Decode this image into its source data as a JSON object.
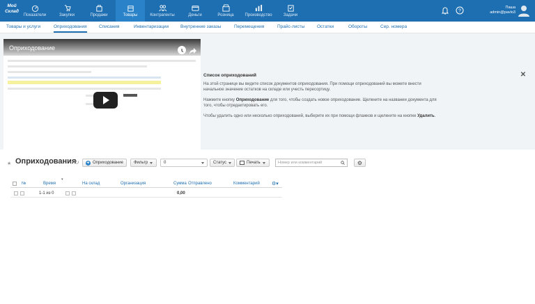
{
  "logo": "Мой Склад",
  "nav": [
    {
      "label": "Показатели",
      "icon": "dashboard-icon"
    },
    {
      "label": "Закупки",
      "icon": "purchases-icon"
    },
    {
      "label": "Продажи",
      "icon": "sales-icon"
    },
    {
      "label": "Товары",
      "icon": "goods-icon",
      "active": true
    },
    {
      "label": "Контрагенты",
      "icon": "contacts-icon"
    },
    {
      "label": "Деньги",
      "icon": "money-icon"
    },
    {
      "label": "Розница",
      "icon": "retail-icon"
    },
    {
      "label": "Производство",
      "icon": "production-icon"
    },
    {
      "label": "Задачи",
      "icon": "tasks-icon"
    }
  ],
  "user": {
    "name": "Паша",
    "account": "admin@pavlo3"
  },
  "subnav": [
    "Товары и услуги",
    "Оприходования",
    "Списания",
    "Инвентаризации",
    "Внутренние заказы",
    "Перемещения",
    "Прайс-листы",
    "Остатки",
    "Обороты",
    "Сер. номера"
  ],
  "help": {
    "video_title": "Оприходование",
    "heading": "Список оприходований",
    "p1": "На этой странице вы видите список документов оприходования. При помощи оприходований вы можете внести начальное значение остатков на складе или учесть пересортицу.",
    "p2_a": "Нажмите кнопку ",
    "p2_b": "Оприходование",
    "p2_c": " для того, чтобы создать новое оприходование. Щелкните на названии документа для того, чтобы отредактировать его.",
    "p3_a": "Чтобы удалить одно или несколько оприходований, выберите их при помощи флажков и щелкните на кнопке ",
    "p3_b": "Удалить",
    "p3_c": "."
  },
  "toolbar": {
    "title": "Оприходования",
    "create_label": "Оприходование",
    "filter_label": "Фильтр",
    "count_value": "0",
    "status_label": "Статус",
    "print_label": "Печать",
    "search_placeholder": "Номер или комментарий"
  },
  "table": {
    "headers": [
      "№",
      "Время",
      "На склад",
      "Организация",
      "Сумма",
      "Отправлено",
      "Комментарий"
    ],
    "pager": "1-1 из 0",
    "total": "0,00"
  },
  "colors": {
    "nav_bg": "#1e6fb2",
    "link": "#1e6fb2",
    "accent": "#2a82c8"
  }
}
